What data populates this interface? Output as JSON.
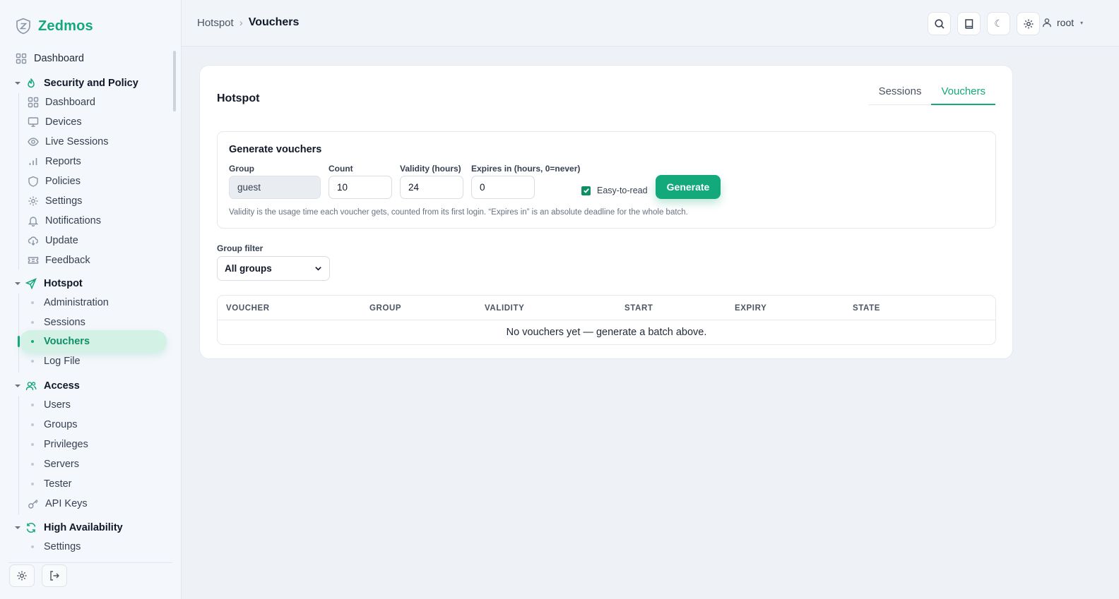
{
  "app": {
    "name": "Zedmos",
    "accent_color": "#14a97a",
    "brand_icon": "shield-icon"
  },
  "sidebar": {
    "top_item": {
      "label": "Dashboard",
      "icon": "grid-icon"
    },
    "sections": [
      {
        "label": "Security and Policy",
        "icon": "flame-icon",
        "items": [
          {
            "label": "Dashboard",
            "icon": "grid-icon"
          },
          {
            "label": "Devices",
            "icon": "monitor-icon"
          },
          {
            "label": "Live Sessions",
            "icon": "eye-icon"
          },
          {
            "label": "Reports",
            "icon": "bar-chart-icon"
          },
          {
            "label": "Policies",
            "icon": "shield-icon"
          },
          {
            "label": "Settings",
            "icon": "gear-icon"
          },
          {
            "label": "Notifications",
            "icon": "bell-icon"
          },
          {
            "label": "Update",
            "icon": "cloud-download-icon"
          },
          {
            "label": "Feedback",
            "icon": "ticket-icon"
          }
        ]
      },
      {
        "label": "Hotspot",
        "icon": "send-icon",
        "items": [
          {
            "label": "Administration"
          },
          {
            "label": "Sessions"
          },
          {
            "label": "Vouchers",
            "active": true
          },
          {
            "label": "Log File"
          }
        ]
      },
      {
        "label": "Access",
        "icon": "users-icon",
        "items": [
          {
            "label": "Users"
          },
          {
            "label": "Groups"
          },
          {
            "label": "Privileges"
          },
          {
            "label": "Servers"
          },
          {
            "label": "Tester"
          },
          {
            "label": "API Keys",
            "icon": "key-icon"
          }
        ]
      },
      {
        "label": "High Availability",
        "icon": "refresh-icon",
        "items": [
          {
            "label": "Settings"
          }
        ]
      }
    ],
    "footer": {
      "settings_icon": "gear-icon",
      "logout_icon": "logout-icon"
    }
  },
  "header": {
    "breadcrumb": {
      "parent": "Hotspot",
      "separator": "›",
      "current": "Vouchers"
    },
    "buttons": {
      "search_icon": "search-icon",
      "docs_icon": "book-icon",
      "theme_glyph": "☾",
      "settings_icon": "gear-icon"
    },
    "user": {
      "name": "root",
      "caret": "▾"
    }
  },
  "main": {
    "title": "Hotspot",
    "tabs": [
      {
        "label": "Sessions",
        "active": false
      },
      {
        "label": "Vouchers",
        "active": true
      }
    ],
    "generate": {
      "title": "Generate vouchers",
      "group_label": "Group",
      "group_value": "guest",
      "count_label": "Count",
      "count_value": "10",
      "validity_label": "Validity (hours)",
      "validity_value": "24",
      "expires_label": "Expires in (hours, 0=never)",
      "expires_value": "0",
      "easy_label": "Easy-to-read",
      "easy_checked": true,
      "button_label": "Generate",
      "hint": "Validity is the usage time each voucher gets, counted from its first login. “Expires in” is an absolute deadline for the whole batch."
    },
    "filter": {
      "label": "Group filter",
      "selected": "All groups"
    },
    "table": {
      "columns": [
        "VOUCHER",
        "GROUP",
        "VALIDITY",
        "START",
        "EXPIRY",
        "STATE"
      ],
      "empty_text": "No vouchers yet — generate a batch above."
    }
  }
}
